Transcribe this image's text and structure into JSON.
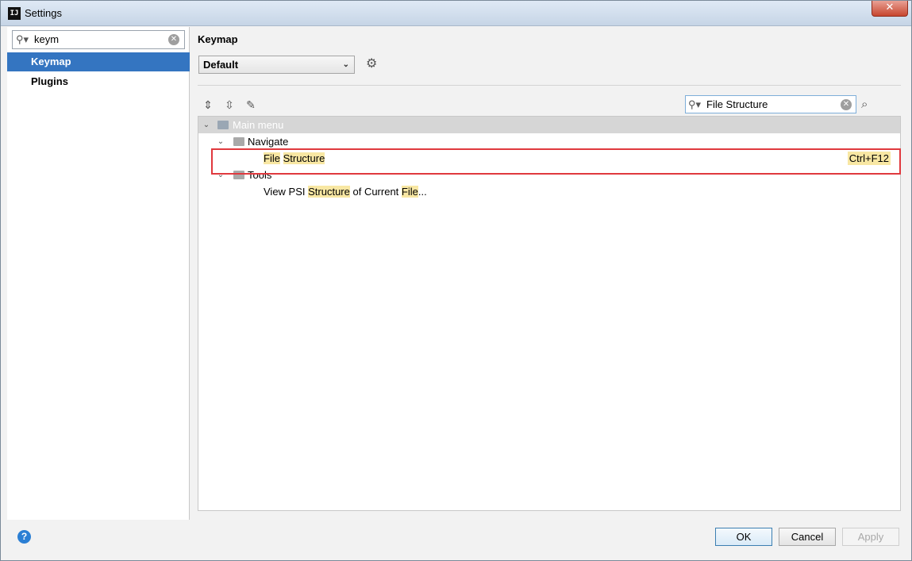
{
  "window": {
    "title": "Settings",
    "app_icon": "IJ",
    "close": "✕"
  },
  "sidebar": {
    "search_value": "keym",
    "items": [
      {
        "label": "Keymap",
        "selected": true
      },
      {
        "label": "Plugins",
        "selected": false
      }
    ]
  },
  "main": {
    "section_title": "Keymap",
    "scheme": "Default",
    "filter_value": "File Structure",
    "tree": {
      "root": "Main menu",
      "groups": [
        {
          "label": "Navigate",
          "actions": [
            {
              "label": "File Structure",
              "shortcut": "Ctrl+F12"
            }
          ]
        },
        {
          "label": "Tools",
          "actions": [
            {
              "label": "View PSI Structure of Current File..."
            }
          ]
        }
      ]
    }
  },
  "footer": {
    "ok": "OK",
    "cancel": "Cancel",
    "apply": "Apply",
    "help": "?"
  },
  "colors": {
    "selection": "#3475c1",
    "highlight": "#f8e7a3",
    "annotation": "#e0393e"
  }
}
